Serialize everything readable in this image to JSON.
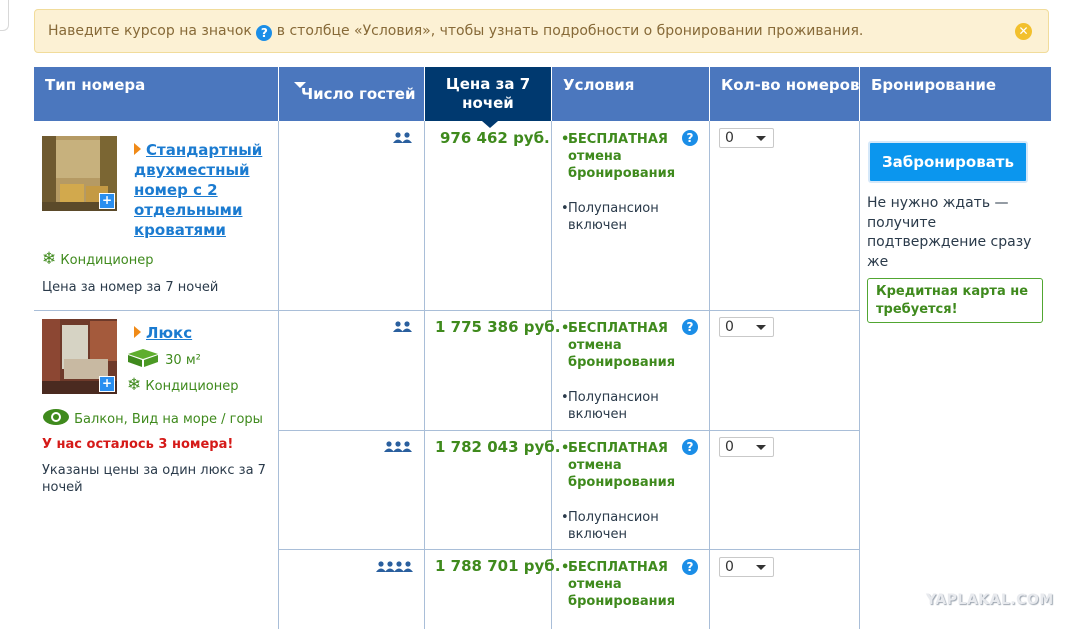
{
  "notice": {
    "text_before": "Наведите курсор на значок",
    "text_after": "в столбце «Условия», чтобы узнать подробности о бронировании проживания.",
    "info_glyph": "?",
    "close_glyph": "✕",
    "bg_color": "#fcf1d4"
  },
  "table": {
    "headers": {
      "room_type": "Тип номера",
      "guests": "Число гостей",
      "price_line1": "Цена за 7",
      "price_line2": "ночей",
      "conditions": "Условия",
      "rooms_count": "Кол-во номеров",
      "booking": "Бронирование"
    },
    "header_color": "#4b77be",
    "active_header_color": "#00396f"
  },
  "rooms": [
    {
      "title_lines": [
        "Стандартный",
        "двухместный",
        "номер с 2",
        "отдельными",
        "кроватями"
      ],
      "amenity": "Кондиционер",
      "price_note": "Цена за номер за 7 ночей",
      "options": [
        {
          "price": "976 462 руб.",
          "free_cancel": [
            "БЕСПЛАТНАЯ",
            "отмена",
            "бронирования"
          ],
          "meal": [
            "Полупансион",
            "включен"
          ],
          "qty": "0"
        }
      ]
    },
    {
      "title_lines": [
        "Люкс"
      ],
      "area": "30 м²",
      "amenity": "Кондиционер",
      "view": "Балкон, Вид на море / горы",
      "warning": "У нас осталось 3 номера!",
      "price_note_lines": [
        "Указаны цены за один люкс за 7",
        "ночей"
      ],
      "options": [
        {
          "price": "1 775 386 руб.",
          "free_cancel": [
            "БЕСПЛАТНАЯ",
            "отмена",
            "бронирования"
          ],
          "meal": [
            "Полупансион",
            "включен"
          ],
          "qty": "0"
        },
        {
          "price": "1 782 043 руб.",
          "free_cancel": [
            "БЕСПЛАТНАЯ",
            "отмена",
            "бронирования"
          ],
          "meal": [
            "Полупансион",
            "включен"
          ],
          "qty": "0"
        },
        {
          "price": "1 788 701 руб.",
          "free_cancel": [
            "БЕСПЛАТНАЯ",
            "отмена",
            "бронирования"
          ],
          "qty": "0"
        }
      ]
    }
  ],
  "booking": {
    "button_label": "Забронировать",
    "note_lines": [
      "Не нужно ждать —",
      "получите",
      "подтверждение сразу",
      "же"
    ],
    "no_card_lines": [
      "Кредитная карта не",
      "требуется!"
    ]
  },
  "icons": {
    "info": "question-circle-icon",
    "close": "close-circle-icon",
    "aircon": "snowflake-icon",
    "area": "cube-icon",
    "view": "eye-icon",
    "guests": "people-icon",
    "photo_expand": "plus-icon"
  },
  "watermark": "YAPLAKAL.COM"
}
